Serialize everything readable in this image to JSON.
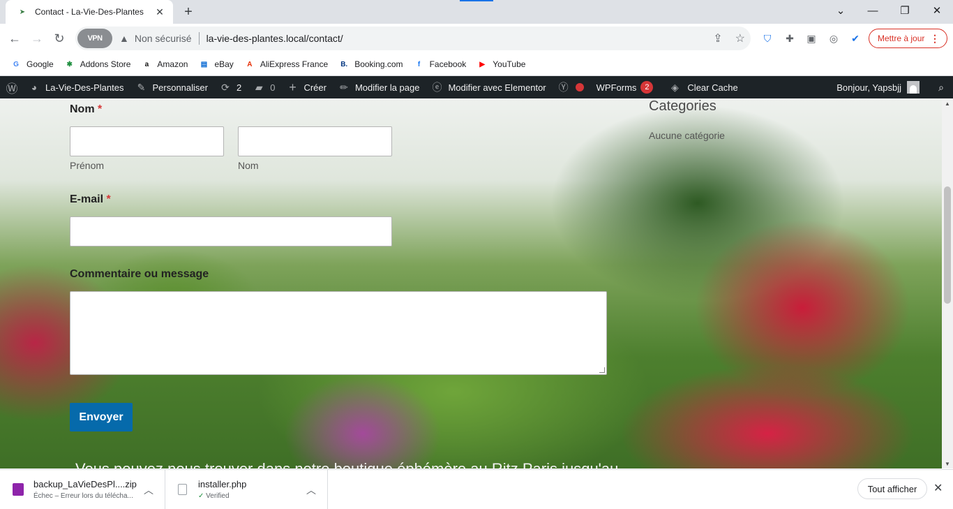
{
  "browser": {
    "tab_title": "Contact - La-Vie-Des-Plantes",
    "vpn_label": "VPN",
    "security_label": "Non sécurisé",
    "url": "la-vie-des-plantes.local/contact/",
    "update_label": "Mettre à jour",
    "icons": {
      "favicon": "leaf-icon",
      "close": "close-icon",
      "new_tab": "plus-icon",
      "back": "back-arrow-icon",
      "forward": "forward-arrow-icon",
      "reload": "reload-icon",
      "warning": "warning-icon",
      "share": "share-icon",
      "star": "star-icon"
    }
  },
  "bookmarks": [
    {
      "label": "Google",
      "icon": "google-icon",
      "color": "#4285f4",
      "glyph": "G"
    },
    {
      "label": "Addons Store",
      "icon": "addons-store-icon",
      "color": "#1e8e3e",
      "glyph": "✱"
    },
    {
      "label": "Amazon",
      "icon": "amazon-icon",
      "color": "#111111",
      "glyph": "a"
    },
    {
      "label": "eBay",
      "icon": "ebay-icon",
      "color": "#0064d2",
      "glyph": "▤"
    },
    {
      "label": "AliExpress France",
      "icon": "aliexpress-icon",
      "color": "#e62e04",
      "glyph": "A"
    },
    {
      "label": "Booking.com",
      "icon": "booking-icon",
      "color": "#003580",
      "glyph": "B."
    },
    {
      "label": "Facebook",
      "icon": "facebook-icon",
      "color": "#1877f2",
      "glyph": "f"
    },
    {
      "label": "YouTube",
      "icon": "youtube-icon",
      "color": "#ff0000",
      "glyph": "▶"
    }
  ],
  "wpbar": {
    "site_name": "La-Vie-Des-Plantes",
    "customize": "Personnaliser",
    "updates_count": "2",
    "comments_count": "0",
    "new": "Créer",
    "edit_page": "Modifier la page",
    "edit_elementor": "Modifier avec Elementor",
    "wpforms": "WPForms",
    "wpforms_badge": "2",
    "clear_cache": "Clear Cache",
    "greeting": "Bonjour, Yapsbjj"
  },
  "form": {
    "name_label": "Nom",
    "required_mark": "*",
    "first_name_sublabel": "Prénom",
    "last_name_sublabel": "Nom",
    "email_label": "E-mail",
    "message_label": "Commentaire ou message",
    "submit_label": "Envoyer"
  },
  "sidebar": {
    "categories_title": "Categories",
    "categories_empty": "Aucune catégorie"
  },
  "footer_text": "Vous pouvez nous trouver dans notre boutique éphémère au Ritz Paris jusqu'au",
  "downloads": [
    {
      "name": "backup_LaVieDesPl....zip",
      "status": "Échec – Erreur lors du télécha..."
    },
    {
      "name": "installer.php",
      "status": "Verified"
    }
  ],
  "downloads_show_all": "Tout afficher"
}
